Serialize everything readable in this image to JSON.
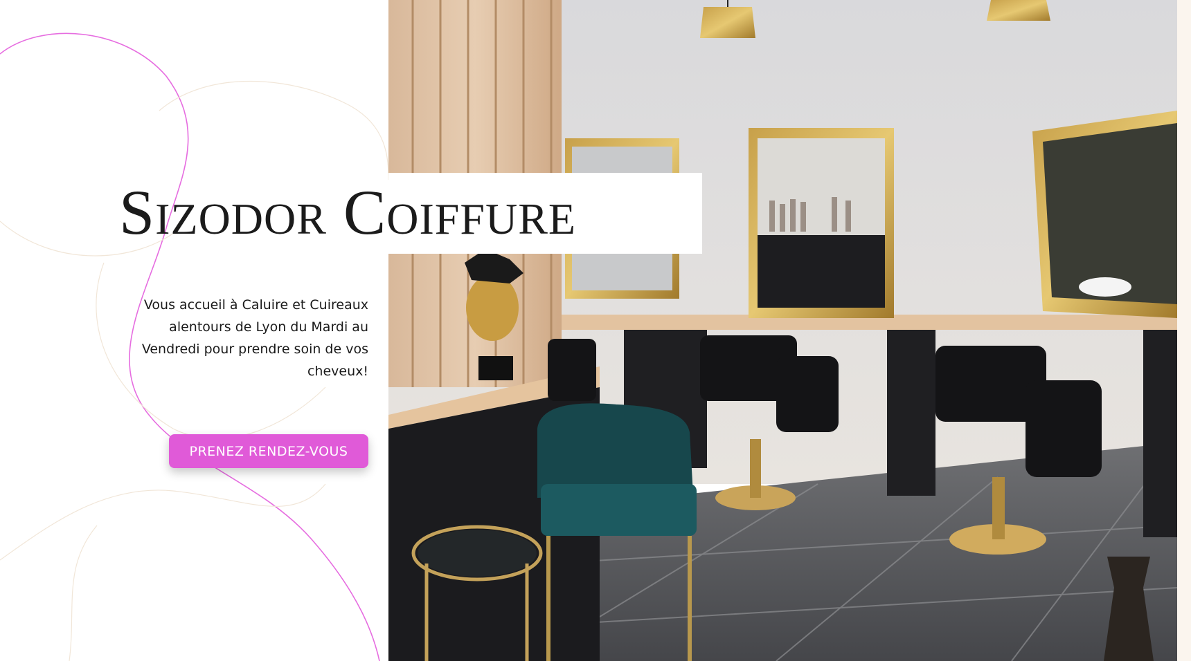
{
  "hero": {
    "title": "Sizodor Coiffure",
    "intro": "Vous accueil à Caluire et Cuireaux alentours de Lyon du Mardi au Vendredi pour prendre soin de vos cheveux!",
    "cta_label": "PRENEZ RENDEZ-VOUS"
  },
  "colors": {
    "accent": "#e05ad8",
    "title_text": "#1b1b1b",
    "body_text": "#1a1a1a",
    "deco_line": "#e66de0"
  },
  "photo": {
    "subject": "salon interior: gold-framed mirrors, black styling chairs, teal velvet armchair, wood slat divider"
  }
}
